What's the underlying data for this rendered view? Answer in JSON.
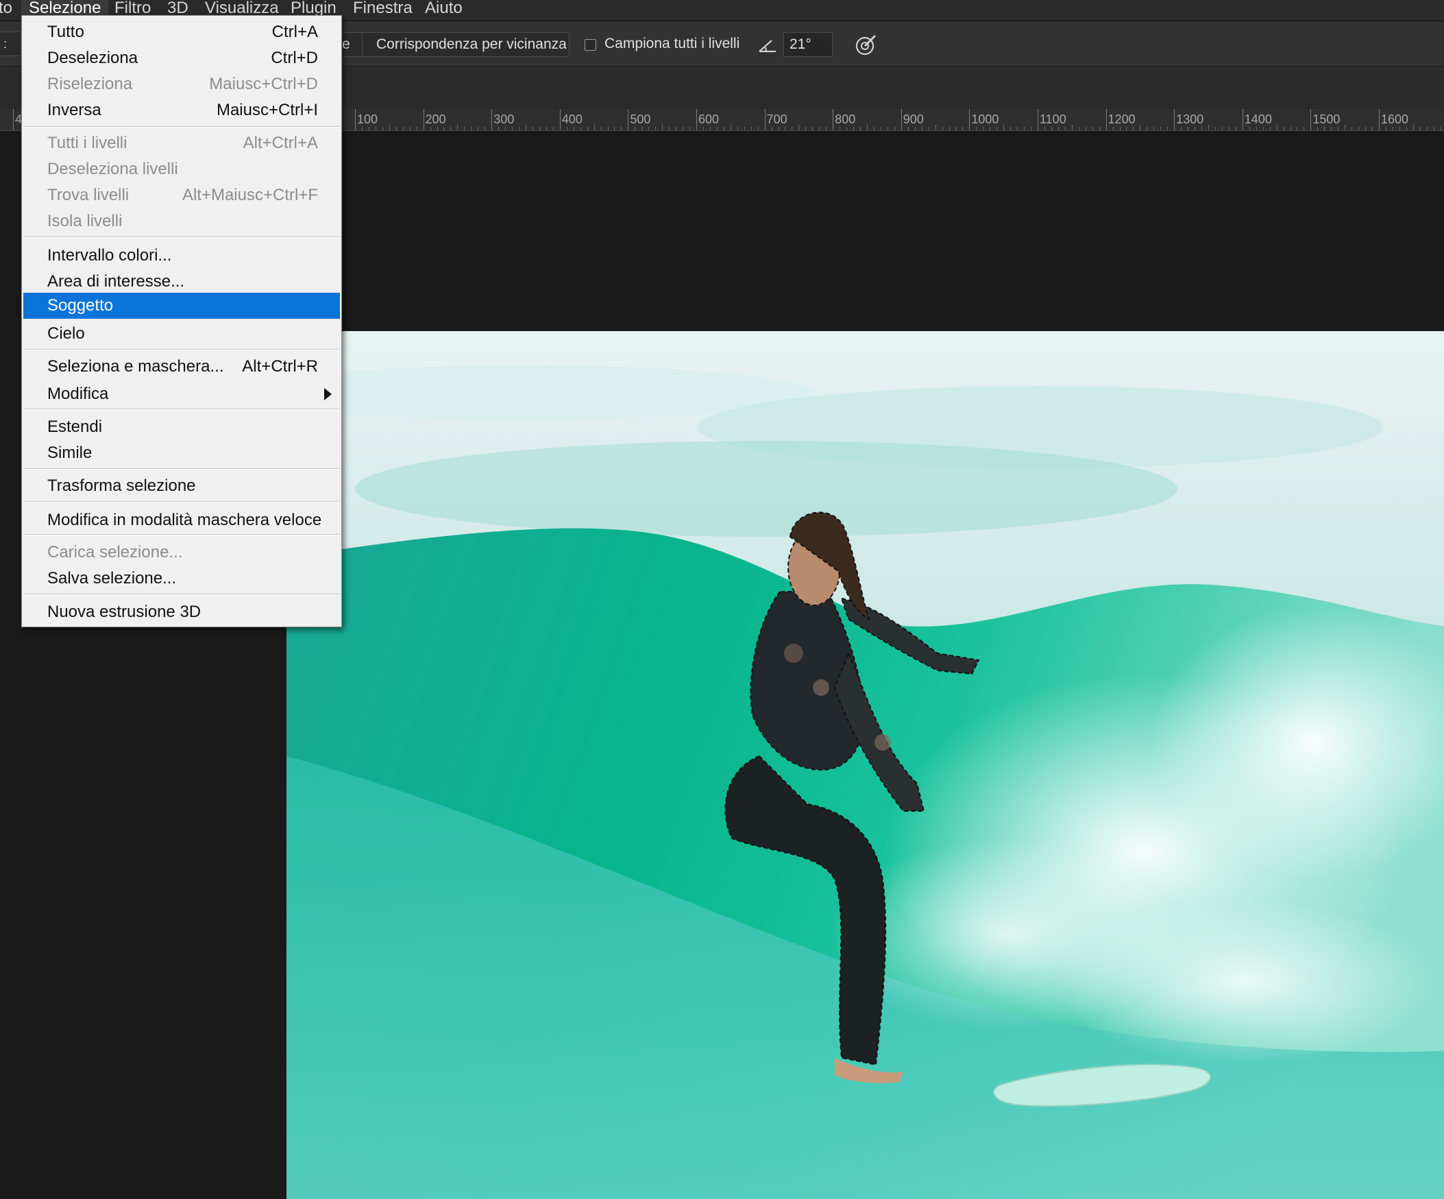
{
  "menubar": {
    "items": [
      {
        "label": "to"
      },
      {
        "label": "Selezione"
      },
      {
        "label": "Filtro"
      },
      {
        "label": "3D"
      },
      {
        "label": "Visualizza"
      },
      {
        "label": "Plugin"
      },
      {
        "label": "Finestra"
      },
      {
        "label": "Aiuto"
      }
    ]
  },
  "options": {
    "partial_button": "e",
    "match_button": "Corrispondenza per vicinanza",
    "sample_all_label": "Campiona tutti i livelli",
    "sample_all_checked": false,
    "angle_value": "21°"
  },
  "ruler": {
    "left_fragment": "4",
    "labels": [
      "100",
      "200",
      "300",
      "400",
      "500",
      "600",
      "700",
      "800",
      "900",
      "1000",
      "1100",
      "1200",
      "1300",
      "1400",
      "1500",
      "1600"
    ]
  },
  "menu": {
    "groups": [
      [
        {
          "label": "Tutto",
          "shortcut": "Ctrl+A",
          "disabled": false
        },
        {
          "label": "Deseleziona",
          "shortcut": "Ctrl+D",
          "disabled": false
        },
        {
          "label": "Riseleziona",
          "shortcut": "Maiusc+Ctrl+D",
          "disabled": true
        },
        {
          "label": "Inversa",
          "shortcut": "Maiusc+Ctrl+I",
          "disabled": false
        }
      ],
      [
        {
          "label": "Tutti i livelli",
          "shortcut": "Alt+Ctrl+A",
          "disabled": true
        },
        {
          "label": "Deseleziona livelli",
          "shortcut": "",
          "disabled": true
        },
        {
          "label": "Trova livelli",
          "shortcut": "Alt+Maiusc+Ctrl+F",
          "disabled": true
        },
        {
          "label": "Isola livelli",
          "shortcut": "",
          "disabled": true
        }
      ],
      [
        {
          "label": "Intervallo colori...",
          "shortcut": "",
          "disabled": false
        },
        {
          "label": "Area di interesse...",
          "shortcut": "",
          "disabled": false
        },
        {
          "label": "Soggetto",
          "shortcut": "",
          "disabled": false,
          "selected": true
        },
        {
          "label": "Cielo",
          "shortcut": "",
          "disabled": false
        }
      ],
      [
        {
          "label": "Seleziona e maschera...",
          "shortcut": "Alt+Ctrl+R",
          "disabled": false
        },
        {
          "label": "Modifica",
          "shortcut": "",
          "disabled": false,
          "submenu": true
        }
      ],
      [
        {
          "label": "Estendi",
          "shortcut": "",
          "disabled": false
        },
        {
          "label": "Simile",
          "shortcut": "",
          "disabled": false
        }
      ],
      [
        {
          "label": "Trasforma selezione",
          "shortcut": "",
          "disabled": false
        }
      ],
      [
        {
          "label": "Modifica in modalità maschera veloce",
          "shortcut": "",
          "disabled": false
        }
      ],
      [
        {
          "label": "Carica selezione...",
          "shortcut": "",
          "disabled": true
        },
        {
          "label": "Salva selezione...",
          "shortcut": "",
          "disabled": false
        }
      ],
      [
        {
          "label": "Nuova estrusione 3D",
          "shortcut": "",
          "disabled": false
        }
      ]
    ]
  },
  "colors": {
    "menu_highlight": "#0b74d8",
    "menu_background": "#f0f0f0",
    "app_background": "#1a1a1a",
    "wave_green": "#14b794"
  }
}
